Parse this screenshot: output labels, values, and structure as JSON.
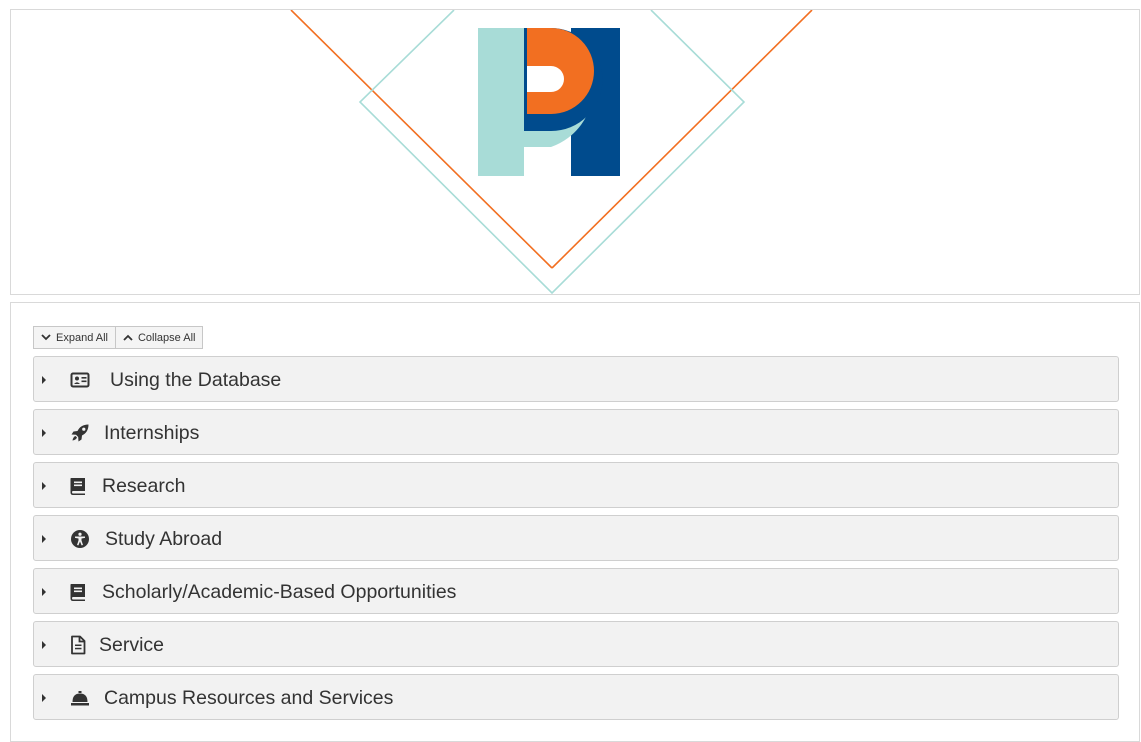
{
  "controls": {
    "expand_label": "Expand All",
    "collapse_label": "Collapse All"
  },
  "colors": {
    "orange": "#f26f21",
    "teal": "#a8dcd7",
    "navy": "#004b8d",
    "panel_bg": "#f2f2f2",
    "text": "#333333"
  },
  "accordion": {
    "items": [
      {
        "label": "Using the Database",
        "icon": "id-card-icon"
      },
      {
        "label": "Internships",
        "icon": "rocket-icon"
      },
      {
        "label": "Research",
        "icon": "book-icon"
      },
      {
        "label": "Study Abroad",
        "icon": "universal-access-icon"
      },
      {
        "label": "Scholarly/Academic-Based Opportunities",
        "icon": "book-icon"
      },
      {
        "label": "Service",
        "icon": "file-text-icon"
      },
      {
        "label": "Campus Resources and Services",
        "icon": "concierge-bell-icon"
      }
    ]
  }
}
